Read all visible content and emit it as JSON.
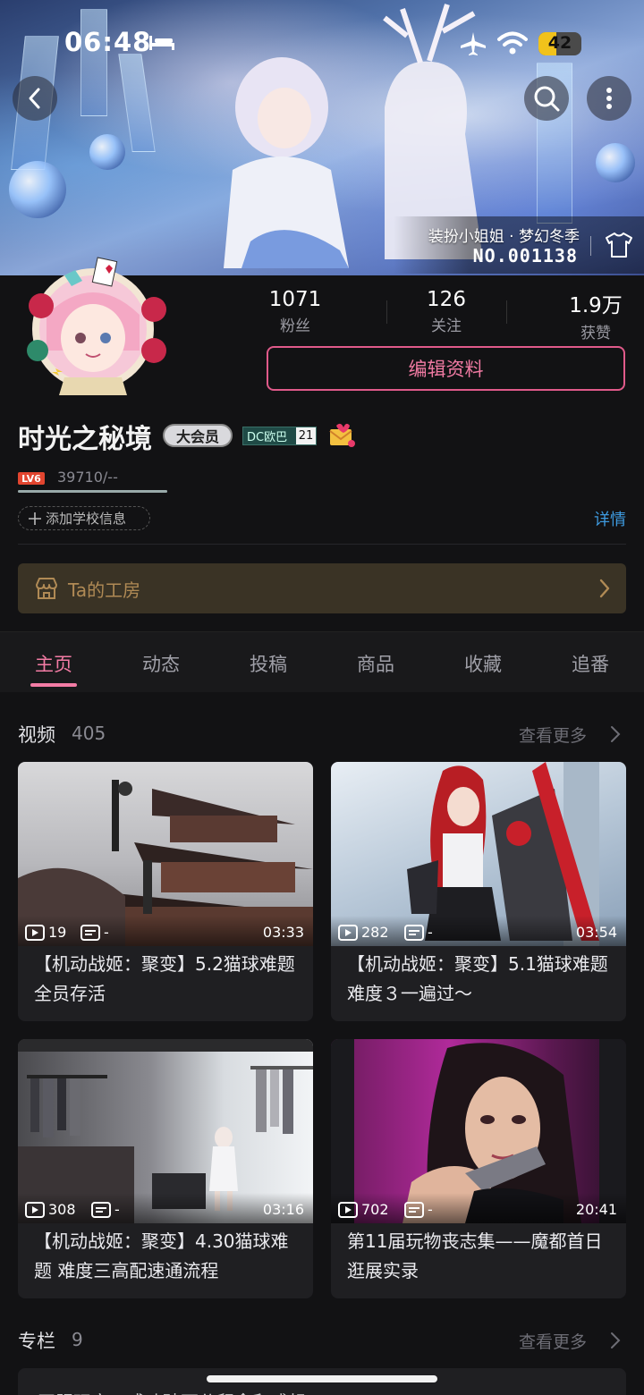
{
  "status_bar": {
    "time": "06:48",
    "battery": "42",
    "battery_level": 0.42
  },
  "banner": {
    "suit_name": "装扮小姐姐 · 梦幻冬季",
    "suit_no": "NO.001138"
  },
  "stats": [
    {
      "value": "1071",
      "label": "粉丝"
    },
    {
      "value": "126",
      "label": "关注"
    },
    {
      "value": "1.9万",
      "label": "获赞"
    }
  ],
  "edit_button": "编辑资料",
  "user": {
    "name": "时光之秘境",
    "vip": "大会员",
    "dc_label": "DC欧巴",
    "dc_level": "21",
    "level": "LV6",
    "exp": "39710/--",
    "exp_progress": 1.0,
    "school_button": "添加学校信息",
    "detail_link": "详情"
  },
  "workshop": {
    "label": "Ta的工房"
  },
  "tabs": [
    "主页",
    "动态",
    "投稿",
    "商品",
    "收藏",
    "追番"
  ],
  "videos_section": {
    "title": "视频",
    "count": "405",
    "more": "查看更多"
  },
  "videos": [
    {
      "title": "【机动战姬：聚变】5.2猫球难题 全员存活",
      "plays": "19",
      "danmu": "-",
      "duration": "03:33"
    },
    {
      "title": "【机动战姬：聚变】5.1猫球难题难度３一遍过～",
      "plays": "282",
      "danmu": "-",
      "duration": "03:54"
    },
    {
      "title": "【机动战姬：聚变】4.30猫球难题 难度三高配速通流程",
      "plays": "308",
      "danmu": "-",
      "duration": "03:16"
    },
    {
      "title": "第11届玩物丧志集——魔都首日逛展实录",
      "plays": "702",
      "danmu": "-",
      "duration": "20:41"
    }
  ],
  "column_section": {
    "title": "专栏",
    "count": "9",
    "more": "查看更多"
  },
  "column_first": {
    "title": "开服玩家：成功破万分留念和感想"
  },
  "colors": {
    "accent": "#f47ca5",
    "link": "#3e9be0",
    "workshop": "#b08a55",
    "bg": "#121214"
  }
}
